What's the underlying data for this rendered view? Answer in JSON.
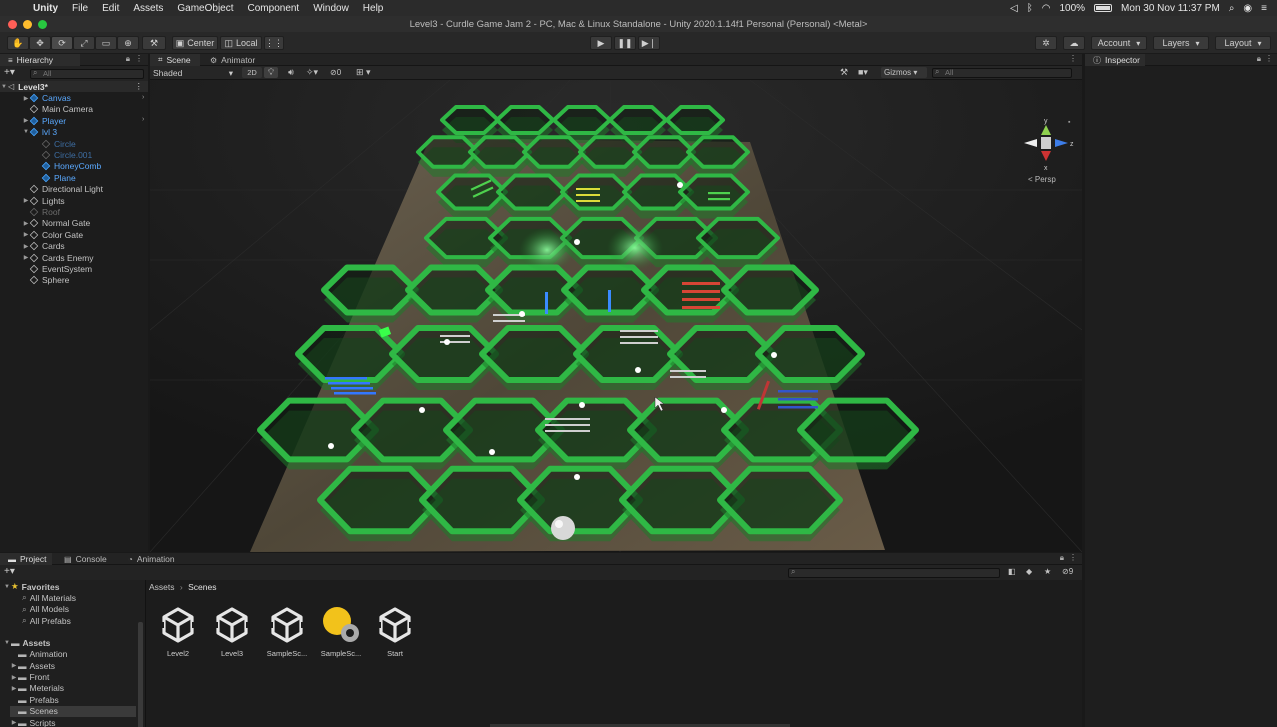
{
  "menubar": {
    "apple_icon": "",
    "items": [
      "Unity",
      "File",
      "Edit",
      "Assets",
      "GameObject",
      "Component",
      "Window",
      "Help"
    ],
    "battery": "100%",
    "clock": "Mon 30 Nov  11:37 PM"
  },
  "window": {
    "title": "Level3 - Curdle Game Jam 2 - PC, Mac & Linux Standalone - Unity 2020.1.14f1 Personal (Personal) <Metal>",
    "traffic_colors": [
      "#ff5f57",
      "#febc2e",
      "#28c840"
    ]
  },
  "toolbar": {
    "pivot_label": "Center",
    "space_label": "Local",
    "account_label": "Account",
    "layers_label": "Layers",
    "layout_label": "Layout",
    "play_icon": "play-icon",
    "pause_icon": "pause-icon",
    "step_icon": "step-icon"
  },
  "hierarchy": {
    "tab_label": "Hierarchy",
    "search_placeholder": "All",
    "scene_name": "Level3*",
    "items": [
      {
        "label": "Canvas",
        "style": "blue",
        "indent": 1,
        "caret": "▶",
        "arrow": true
      },
      {
        "label": "Main Camera",
        "style": "normal",
        "indent": 1,
        "caret": ""
      },
      {
        "label": "Player",
        "style": "blue",
        "indent": 1,
        "caret": "▶",
        "arrow": true
      },
      {
        "label": "lvl 3",
        "style": "blue",
        "indent": 1,
        "caret": "▼"
      },
      {
        "label": "Circle",
        "style": "dimblue",
        "indent": 2,
        "caret": ""
      },
      {
        "label": "Circle.001",
        "style": "dimblue",
        "indent": 2,
        "caret": ""
      },
      {
        "label": "HoneyComb",
        "style": "blue",
        "indent": 2,
        "caret": ""
      },
      {
        "label": "Plane",
        "style": "blue",
        "indent": 2,
        "caret": ""
      },
      {
        "label": "Directional Light",
        "style": "normal",
        "indent": 1,
        "caret": ""
      },
      {
        "label": "Lights",
        "style": "normal",
        "indent": 1,
        "caret": "▶"
      },
      {
        "label": "Roof",
        "style": "dim",
        "indent": 1,
        "caret": ""
      },
      {
        "label": "Normal Gate",
        "style": "normal",
        "indent": 1,
        "caret": "▶"
      },
      {
        "label": "Color Gate",
        "style": "normal",
        "indent": 1,
        "caret": "▶"
      },
      {
        "label": "Cards",
        "style": "normal",
        "indent": 1,
        "caret": "▶"
      },
      {
        "label": "Cards Enemy",
        "style": "normal",
        "indent": 1,
        "caret": "▶"
      },
      {
        "label": "EventSystem",
        "style": "normal",
        "indent": 1,
        "caret": ""
      },
      {
        "label": "Sphere",
        "style": "normal",
        "indent": 1,
        "caret": ""
      }
    ]
  },
  "scene": {
    "tabs": [
      "Scene",
      "Animator"
    ],
    "shading_mode": "Shaded",
    "toggle_2d": "2D",
    "hidden_count": "0",
    "gizmos_label": "Gizmos",
    "search_placeholder": "All",
    "gizmo_axes": {
      "y": "y",
      "x": "x",
      "z": "z"
    },
    "persp_label": "< Persp",
    "wall_color": "#1f7a2a",
    "rim_color": "#2fb845",
    "ground_color": "#5d5446"
  },
  "bottom": {
    "tabs": [
      "Project",
      "Console",
      "Animation"
    ],
    "breadcrumb": [
      "Assets",
      "Scenes"
    ],
    "hidden_count": "9",
    "favorites_label": "Favorites",
    "favorites": [
      "All Materials",
      "All Models",
      "All Prefabs"
    ],
    "assets_label": "Assets",
    "folders": [
      "Animation",
      "Assets",
      "Front",
      "Meterials",
      "Prefabs",
      "Scenes",
      "Scripts"
    ],
    "selected_folder": "Scenes",
    "files": [
      "Level2",
      "Level3",
      "SampleSc...",
      "SampleSc...",
      "Start"
    ]
  },
  "inspector": {
    "tab_label": "Inspector"
  }
}
